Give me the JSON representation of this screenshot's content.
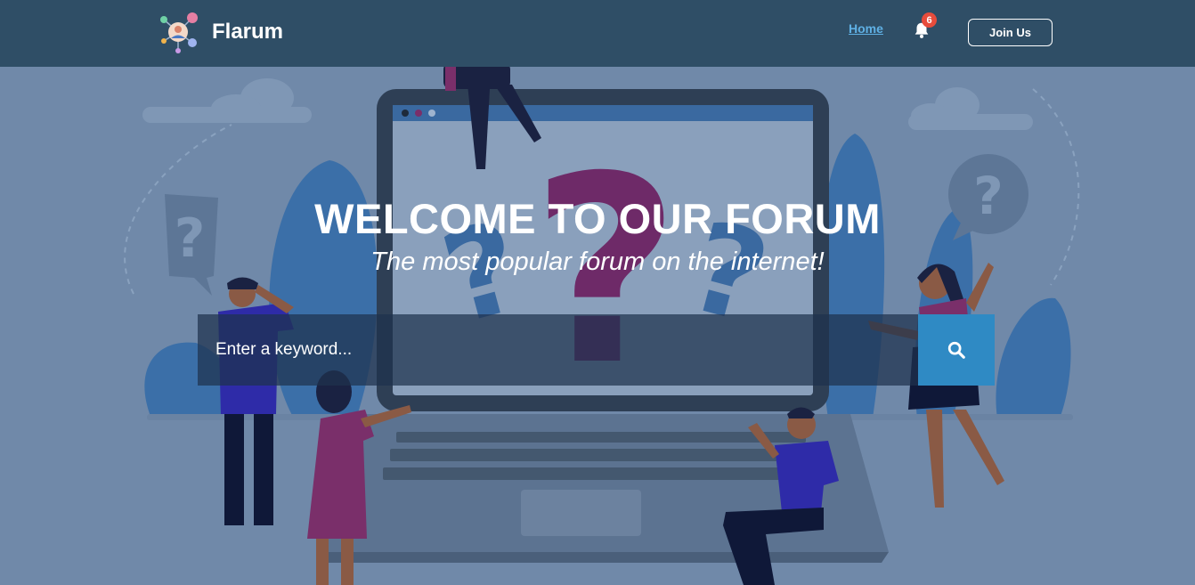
{
  "header": {
    "brand_name": "Flarum",
    "nav_home": "Home",
    "notification_count": "6",
    "join_label": "Join Us"
  },
  "hero": {
    "title": "WELCOME TO OUR FORUM",
    "subtitle": "The most popular forum on the internet!"
  },
  "search": {
    "placeholder": "Enter a keyword...",
    "icon": "search-icon"
  },
  "colors": {
    "header_bg": "#2f4e66",
    "hero_bg": "#7089a9",
    "accent": "#2f8ac4",
    "link": "#5fb0e4",
    "badge": "#e74c3c"
  }
}
